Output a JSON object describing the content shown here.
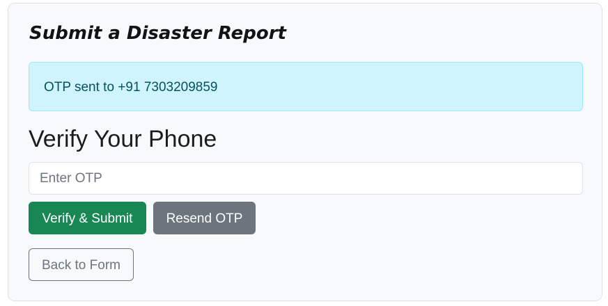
{
  "card": {
    "title": "Submit a Disaster Report",
    "alert_text": "OTP sent to +91 7303209859",
    "subheading": "Verify Your Phone",
    "otp_input": {
      "value": "",
      "placeholder": "Enter OTP"
    },
    "buttons": {
      "verify_submit": "Verify & Submit",
      "resend_otp": "Resend OTP",
      "back_to_form": "Back to Form"
    }
  },
  "colors": {
    "page_background": "#ffffff",
    "card_background": "#f8f9fa",
    "alert_background": "#cff4fc",
    "alert_text": "#055160",
    "verify_button": "#198754",
    "resend_button": "#6c757d",
    "back_button_outline": "#6c757d"
  }
}
